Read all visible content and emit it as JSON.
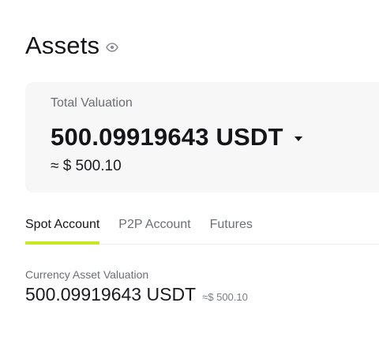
{
  "header": {
    "title": "Assets",
    "visibility_icon": "eye-icon"
  },
  "valuation_card": {
    "label": "Total Valuation",
    "value": "500.09919643 USDT",
    "currency_selector_icon": "caret-down-icon",
    "approx": "≈ $ 500.10"
  },
  "tabs": [
    {
      "label": "Spot Account",
      "active": true
    },
    {
      "label": "P2P Account",
      "active": false
    },
    {
      "label": "Futures",
      "active": false
    }
  ],
  "spot_account": {
    "label": "Currency Asset Valuation",
    "value": "500.09919643 USDT",
    "approx": "≈$ 500.10"
  },
  "colors": {
    "accent_underline": "#c9e81f",
    "card_background": "#f7f7f8",
    "muted_text": "#6b6e73",
    "primary_text": "#151519"
  }
}
